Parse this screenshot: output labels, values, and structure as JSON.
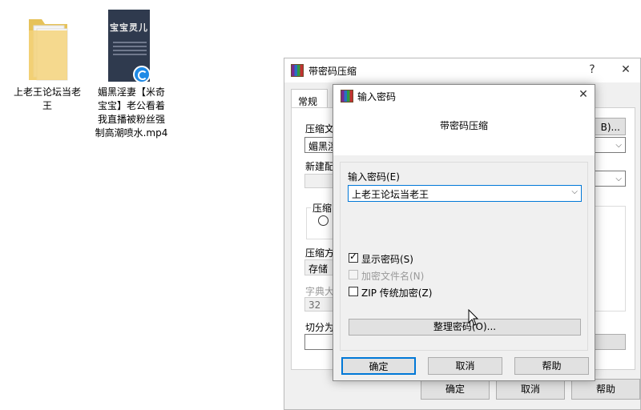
{
  "desktop": {
    "icons": [
      {
        "label_line1": "上老王论坛当老",
        "label_line2": "王",
        "icon": "folder-icon"
      },
      {
        "label_line1": "媚黑淫妻【米奇",
        "label_line2": "宝宝】老公看着",
        "label_line3": "我直播被粉丝强",
        "label_line4": "制高潮喷水.mp4",
        "thumb_title": "宝宝灵儿",
        "icon": "video-file-icon"
      }
    ]
  },
  "back_window": {
    "title": "带密码压缩",
    "help_glyph": "?",
    "close_glyph": "✕",
    "tab_general": "常规",
    "archive_name_label": "压缩文",
    "archive_name_value": "媚黑淫",
    "browse_button": "B)...",
    "profile_label": "新建配",
    "archive_format_label": "压缩",
    "method_label": "压缩方",
    "method_value": "存储",
    "dict_label": "字典大",
    "dict_value": "32",
    "split_label": "切分为",
    "ok_button": "确定",
    "cancel_button": "取消",
    "help_button": "帮助"
  },
  "dialog": {
    "title": "输入密码",
    "close_glyph": "✕",
    "subtitle": "带密码压缩",
    "password_label": "输入密码(E)",
    "password_value": "上老王论坛当老王",
    "show_password_label": "显示密码(S)",
    "show_password_checked": true,
    "encrypt_names_label": "加密文件名(N)",
    "encrypt_names_checked": false,
    "encrypt_names_enabled": false,
    "zip_legacy_label": "ZIP 传统加密(Z)",
    "zip_legacy_checked": false,
    "organize_button": "整理密码(O)...",
    "ok_button": "确定",
    "cancel_button": "取消",
    "help_button": "帮助",
    "check_glyph": "✓",
    "dropdown_glyph": "⌵"
  },
  "colors": {
    "accent": "#0078d7",
    "dialog_bg": "#f0f0f0"
  }
}
